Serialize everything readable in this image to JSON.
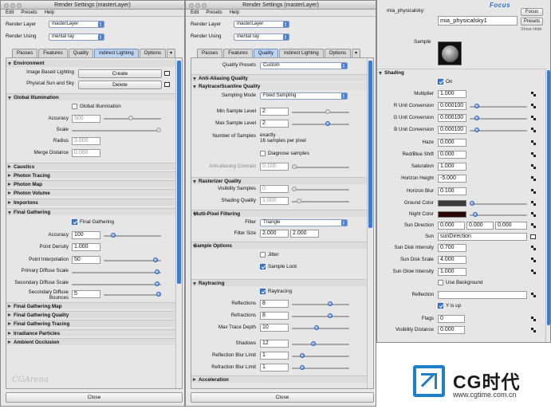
{
  "win1": {
    "title": "Render Settings (masterLayer)",
    "menu": [
      "Edit",
      "Presets",
      "Help"
    ],
    "render_layer_label": "Render Layer",
    "render_layer": "masterLayer",
    "render_using_label": "Render Using",
    "render_using": "mental ray",
    "tabs": [
      "Passes",
      "Features",
      "Quality",
      "Indirect Lighting",
      "Options"
    ],
    "env": {
      "title": "Environment",
      "ibl_label": "Image Based Lighting",
      "ibl_btn": "Create",
      "sun_label": "Physical Sun and Sky",
      "sun_btn": "Delete"
    },
    "gi": {
      "title": "Global Illumination",
      "chk": "Global Illumination",
      "accuracy_label": "Accuracy",
      "accuracy": "500",
      "scale_label": "Scale",
      "radius_label": "Radius",
      "radius": "3.000",
      "merge_label": "Merge Distance",
      "merge": "0.000"
    },
    "collapsed1": [
      "Caustics",
      "Photon Tracing",
      "Photon Map",
      "Photon Volume",
      "Importons"
    ],
    "fg": {
      "title": "Final Gathering",
      "chk": "Final Gathering",
      "accuracy_label": "Accuracy",
      "accuracy": "100",
      "density_label": "Point Density",
      "density": "1.000",
      "interp_label": "Point Interpolation",
      "interp": "50",
      "primary_label": "Primary Diffuse Scale",
      "secondary_label": "Secondary Diffuse Scale",
      "bounces_label1": "Secondary Diffuse",
      "bounces_label2": "Bounces",
      "bounces": "5"
    },
    "collapsed2": [
      "Final Gathering Map",
      "Final Gathering Quality",
      "Final Gathering Tracing",
      "Irradiance Particles",
      "Ambient Occlusion"
    ],
    "close": "Close",
    "watermark": "CGArena"
  },
  "win2": {
    "title": "Render Settings (masterLayer)",
    "menu": [
      "Edit",
      "Presets",
      "Help"
    ],
    "render_layer_label": "Render Layer",
    "render_layer": "masterLayer",
    "render_using_label": "Render Using",
    "render_using": "mental ray",
    "tabs": [
      "Passes",
      "Features",
      "Quality",
      "Indirect Lighting",
      "Options"
    ],
    "qp_label": "Quality Presets",
    "qp": "Custom",
    "aa": {
      "title": "Anti-Aliasing Quality",
      "sub": "Raytrace/Scanline Quality",
      "mode_label": "Sampling Mode",
      "mode": "Fixed Sampling",
      "min_label": "Min Sample Level",
      "min": "2",
      "max_label": "Max Sample Level",
      "max": "2",
      "num_label": "Number of Samples",
      "num1": "exactly",
      "num2": "16 samples per pixel",
      "diag": "Diagnose samples",
      "contrast_label": "Anti-aliasing Contrast",
      "contrast": "0.100"
    },
    "rq": {
      "title": "Rasterizer Quality",
      "vis_label": "Visibility Samples",
      "vis": "0",
      "shade_label": "Shading Quality",
      "shade": "1.000"
    },
    "mpf": {
      "title": "Multi-Pixel Filtering",
      "filter_label": "Filter",
      "filter": "Triangle",
      "size_label": "Filter Size",
      "size1": "2.000",
      "size2": "2.000"
    },
    "so": {
      "title": "Sample Options",
      "jitter": "Jitter",
      "lock": "Sample Lock"
    },
    "rt": {
      "title": "Raytracing",
      "chk": "Raytracing",
      "refl_label": "Reflections",
      "refl": "8",
      "refr_label": "Refractions",
      "refr": "8",
      "depth_label": "Max Trace Depth",
      "depth": "10",
      "shadows_label": "Shadows",
      "shadows": "12",
      "rbl_label": "Reflection Blur Limit",
      "rbl": "1",
      "fbl_label": "Refraction Blur Limit",
      "fbl": "1"
    },
    "accel": "Acceleration",
    "close": "Close"
  },
  "win3": {
    "name_label": "mia_physicalsky:",
    "name": "mia_physicalsky1",
    "focus": "Focus",
    "presets": "Presets",
    "show": "Show",
    "hide": "Hide",
    "sample_label": "Sample",
    "shading_title": "Shading",
    "on": "On",
    "rows": [
      {
        "label": "Multiplier",
        "value": "1.000"
      },
      {
        "label": "R Unit Conversion",
        "value": "0.000100"
      },
      {
        "label": "G Unit Conversion",
        "value": "0.000100"
      },
      {
        "label": "B Unit Conversion",
        "value": "0.000100"
      },
      {
        "label": "Haze",
        "value": "0.000"
      },
      {
        "label": "Red/Blue Shift",
        "value": "0.000"
      },
      {
        "label": "Saturation",
        "value": "1.000"
      },
      {
        "label": "Horizon Height",
        "value": "-5.000"
      },
      {
        "label": "Horizon Blur",
        "value": "0.100"
      }
    ],
    "ground_label": "Ground Color",
    "night_label": "Night Color",
    "sundir_label": "Sun Direction",
    "sundir": [
      "0.000",
      "0.000",
      "0.000"
    ],
    "sun_label": "Sun",
    "sun": "sunDirection",
    "rows2": [
      {
        "label": "Sun Disk Intensity",
        "value": "0.700"
      },
      {
        "label": "Sun Disk Scale",
        "value": "4.000"
      },
      {
        "label": "Sun Glow Intensity",
        "value": "1.000"
      }
    ],
    "usebg": "Use Background",
    "reflection_label": "Reflection",
    "yup": "Y is up",
    "flags_label": "Flags",
    "flags": "0",
    "vis_label": "Visibility Distance",
    "vis": "0.000",
    "colors": {
      "ground": "#3a3a3a",
      "night": "#2a0806"
    }
  },
  "brand": {
    "name": "CG时代",
    "url": "www.cgtime.com.cn",
    "top": "Focus"
  }
}
